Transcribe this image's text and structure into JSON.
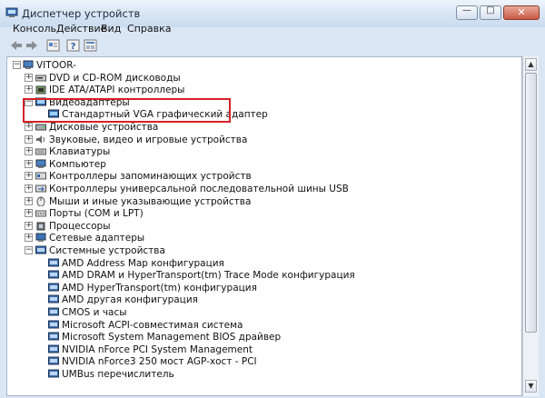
{
  "window": {
    "title": "Диспетчер устройств",
    "buttons": {
      "minimize": "—",
      "maximize": "□",
      "close": "✕"
    }
  },
  "menu": [
    "Консоль",
    "Действие",
    "Вид",
    "Справка"
  ],
  "toolbar": [
    "back-arrow-icon",
    "forward-arrow-icon",
    "properties-icon",
    "help-icon",
    "details-icon"
  ],
  "tree": {
    "root": {
      "label": "VITOOR-",
      "expander": "−"
    },
    "categories": [
      {
        "label": "DVD и CD-ROM дисководы",
        "icon": "dvd-drive-icon",
        "expander": "+"
      },
      {
        "label": "IDE ATA/ATAPI контроллеры",
        "icon": "ide-controller-icon",
        "expander": "+"
      },
      {
        "label": "Видеоадаптеры",
        "icon": "display-adapter-icon",
        "expander": "−",
        "children": [
          {
            "label": "Стандартный VGA графический адаптер",
            "icon": "display-adapter-icon"
          }
        ]
      },
      {
        "label": "Дисковые устройства",
        "icon": "disk-drive-icon",
        "expander": "+"
      },
      {
        "label": "Звуковые, видео и игровые устройства",
        "icon": "sound-icon",
        "expander": "+"
      },
      {
        "label": "Клавиатуры",
        "icon": "keyboard-icon",
        "expander": "+"
      },
      {
        "label": "Компьютер",
        "icon": "computer-icon",
        "expander": "+"
      },
      {
        "label": "Контроллеры запоминающих устройств",
        "icon": "storage-controller-icon",
        "expander": "+"
      },
      {
        "label": "Контроллеры универсальной последовательной шины USB",
        "icon": "usb-icon",
        "expander": "+"
      },
      {
        "label": "Мыши и иные указывающие устройства",
        "icon": "mouse-icon",
        "expander": "+"
      },
      {
        "label": "Порты (COM и LPT)",
        "icon": "port-icon",
        "expander": "+"
      },
      {
        "label": "Процессоры",
        "icon": "processor-icon",
        "expander": "+"
      },
      {
        "label": "Сетевые адаптеры",
        "icon": "network-adapter-icon",
        "expander": "+"
      },
      {
        "label": "Системные устройства",
        "icon": "system-device-icon",
        "expander": "−",
        "children": [
          {
            "label": "AMD Address Map конфигурация",
            "icon": "system-device-icon"
          },
          {
            "label": "AMD DRAM и HyperTransport(tm) Trace Mode конфигурация",
            "icon": "system-device-icon"
          },
          {
            "label": "AMD HyperTransport(tm) конфигурация",
            "icon": "system-device-icon"
          },
          {
            "label": "AMD другая конфигурация",
            "icon": "system-device-icon"
          },
          {
            "label": "CMOS и часы",
            "icon": "system-device-icon"
          },
          {
            "label": "Microsoft ACPI-совместимая система",
            "icon": "system-device-icon"
          },
          {
            "label": "Microsoft System Management BIOS драйвер",
            "icon": "system-device-icon"
          },
          {
            "label": "NVIDIA nForce PCI System Management",
            "icon": "system-device-icon"
          },
          {
            "label": "NVIDIA nForce3 250 мост AGP-хост - PCI",
            "icon": "system-device-icon"
          },
          {
            "label": "UMBus перечислитель",
            "icon": "system-device-icon"
          }
        ]
      }
    ]
  },
  "colors": {
    "highlight_box": "#d42128",
    "chrome": "#dbe6f4"
  }
}
